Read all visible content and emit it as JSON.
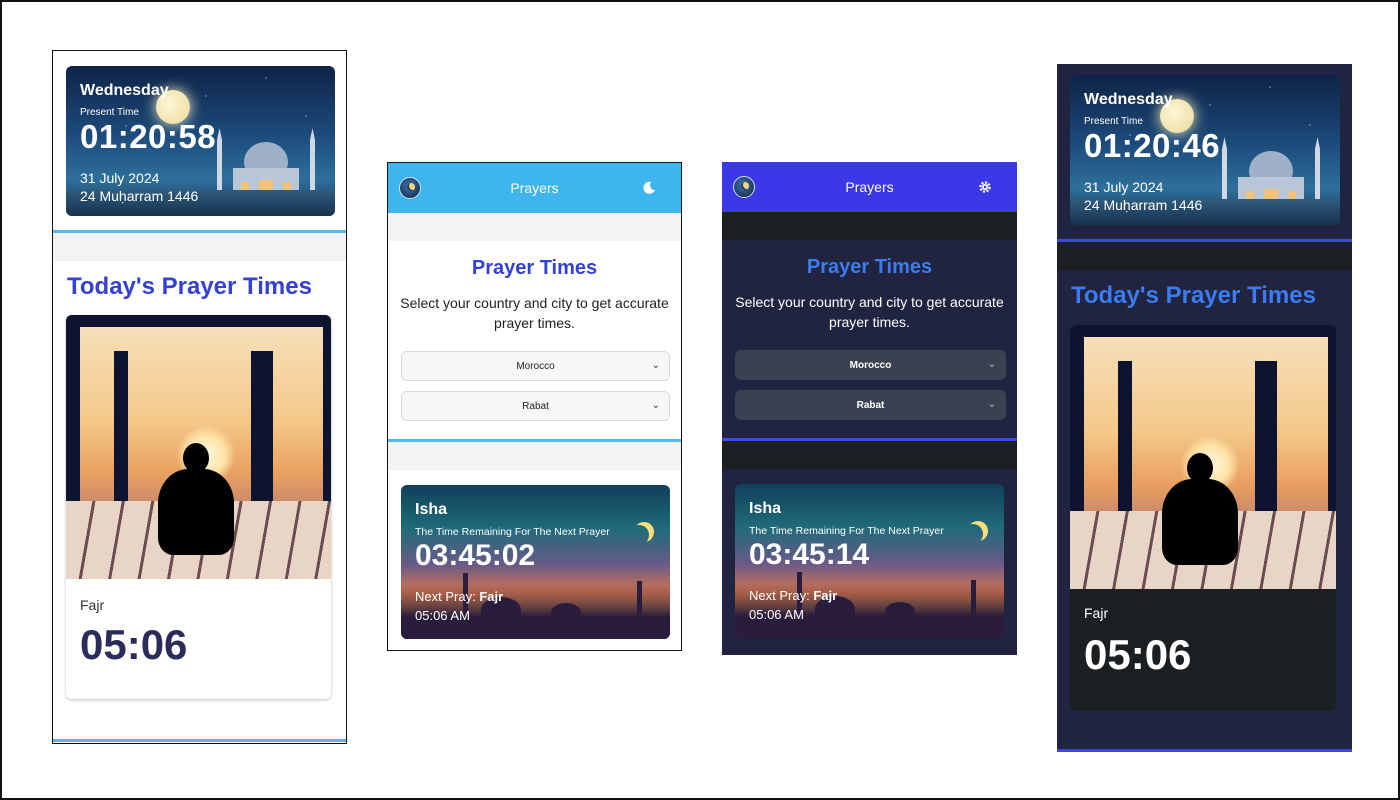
{
  "present": {
    "day": "Wednesday",
    "label": "Present Time",
    "time_a": "01:20:58",
    "time_b": "01:20:46",
    "gregorian": "31 July 2024",
    "hijri": "24 Muḥarram 1446"
  },
  "today": {
    "title": "Today's Prayer Times",
    "prayer_name": "Fajr",
    "prayer_time": "05:06"
  },
  "header": {
    "title": "Prayers",
    "light_toggle_icon": "moon-icon",
    "dark_toggle_icon": "gear-icon"
  },
  "form": {
    "title": "Prayer Times",
    "description": "Select your country and city to get accurate prayer times.",
    "country": "Morocco",
    "city": "Rabat"
  },
  "next": {
    "name": "Isha",
    "remaining_label": "The Time Remaining For The Next Prayer",
    "countdown_a": "03:45:02",
    "countdown_b": "03:45:14",
    "next_label": "Next Pray:",
    "next_name": "Fajr",
    "next_time": "05:06 AM"
  },
  "colors": {
    "accent_blue": "#3441d6",
    "light_header": "#3fb5ee",
    "dark_header": "#3b38e8",
    "dark_bg": "#202440"
  }
}
